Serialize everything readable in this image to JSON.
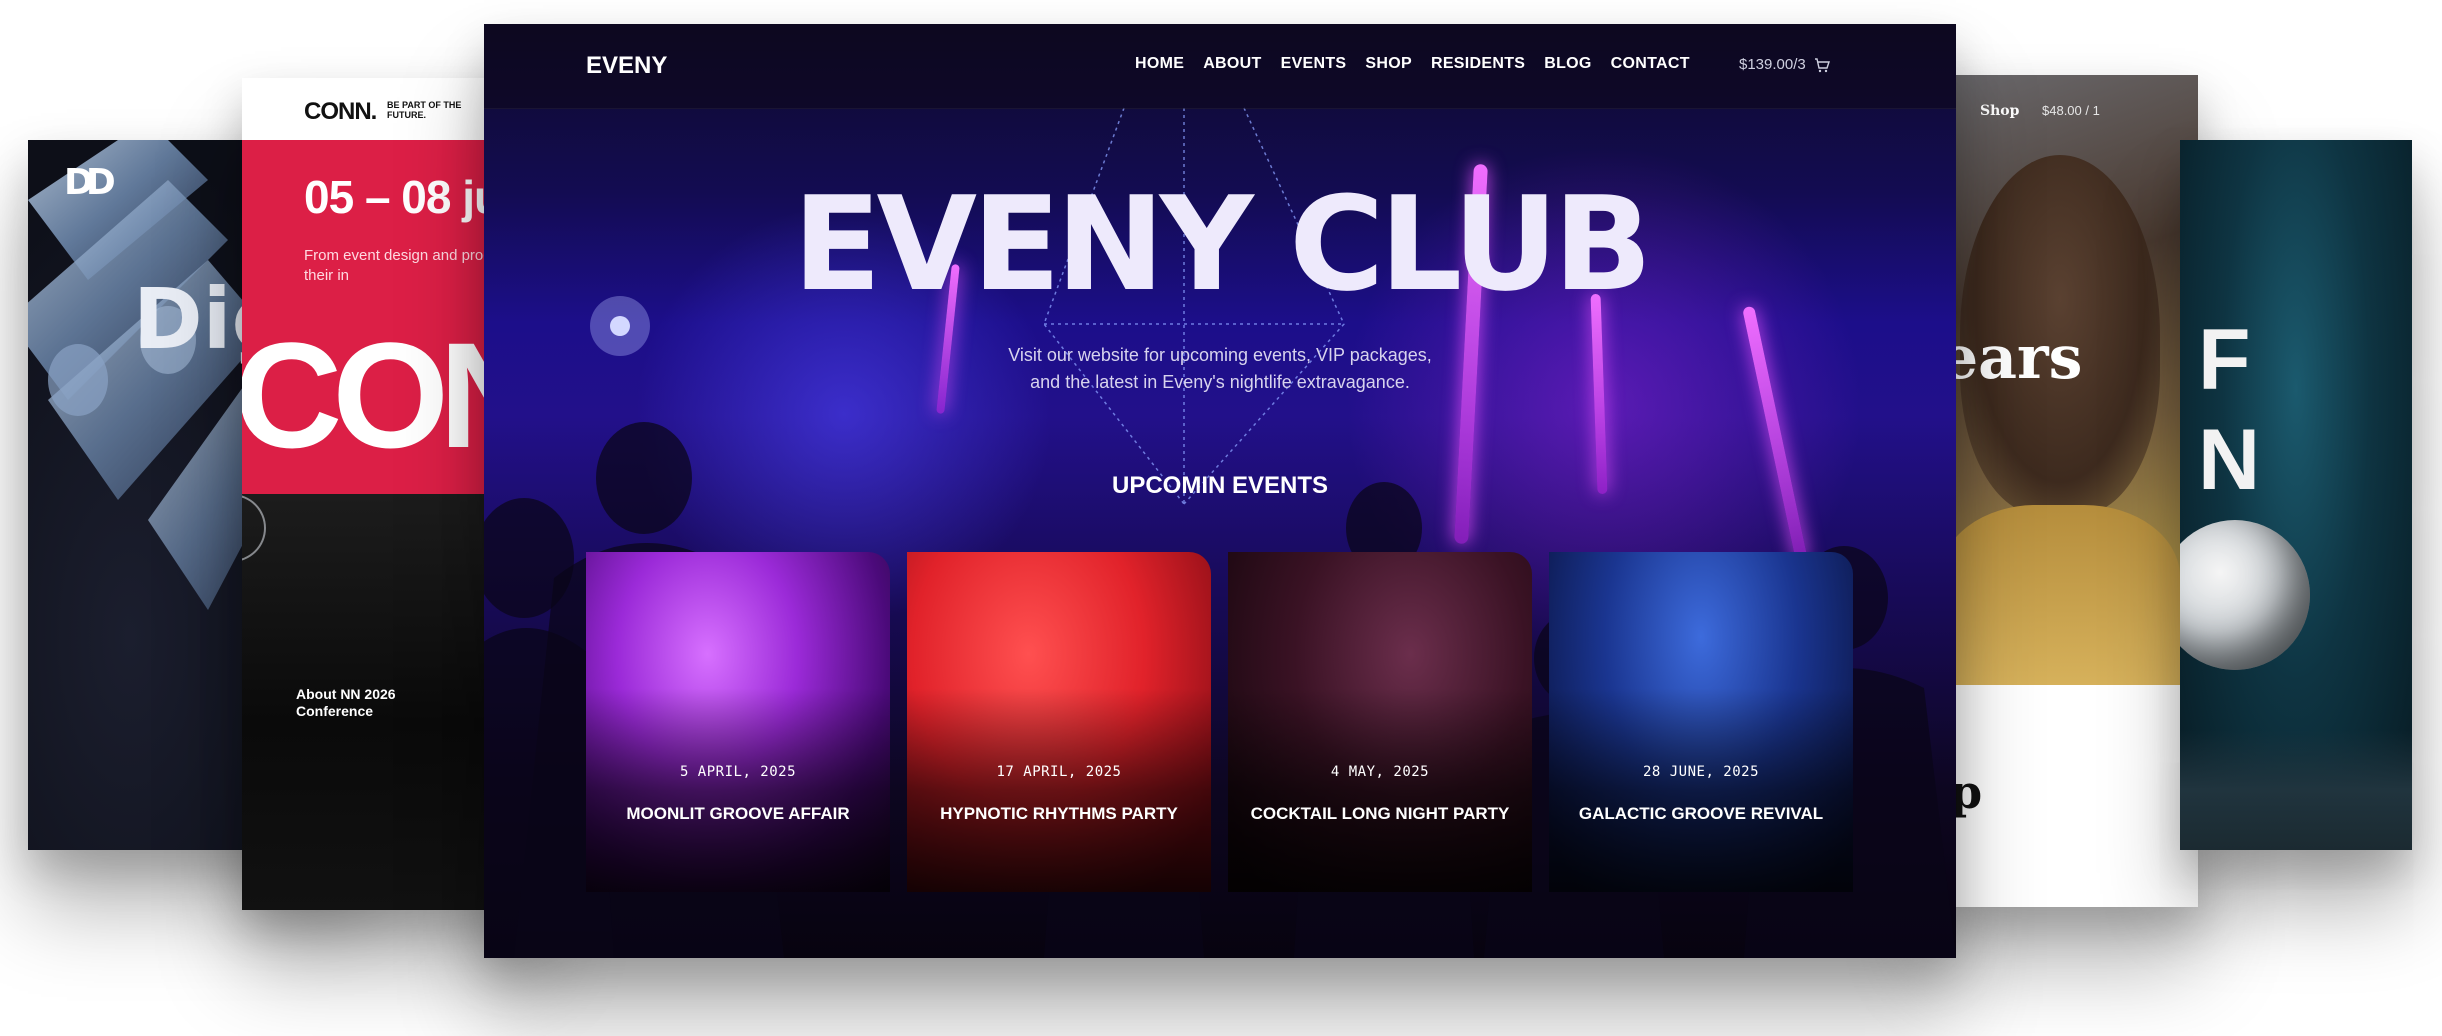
{
  "side_left": {
    "logo": "DD",
    "title": "Dig"
  },
  "conn": {
    "logo": "CONN.",
    "tagline": "BE PART OF THE FUTURE.",
    "date": "05 – 08 ju",
    "description": "From event design and proc speakers will share their in",
    "big_text": "CON",
    "about": "About NN 2026 Conference"
  },
  "side_right": {
    "nav_shop": "Shop",
    "nav_price": "$48.00 / 1",
    "title": "ears",
    "partial": "p"
  },
  "side_far_right": {
    "title_line1": "F",
    "title_line2": "N"
  },
  "main": {
    "logo": "EVENY",
    "nav": [
      "HOME",
      "ABOUT",
      "EVENTS",
      "SHOP",
      "RESIDENTS",
      "BLOG",
      "CONTACT"
    ],
    "cart": "$139.00/3",
    "hero_title": "EVENY CLUB",
    "hero_subtitle_line1": "Visit our website for upcoming events, VIP packages,",
    "hero_subtitle_line2": "and the latest in Eveny's nightlife extravagance.",
    "section_title": "UPCOMIN EVENTS",
    "events": [
      {
        "date": "5 APRIL, 2025",
        "name": "MOONLIT GROOVE AFFAIR"
      },
      {
        "date": "17 APRIL, 2025",
        "name": "HYPNOTIC RHYTHMS PARTY"
      },
      {
        "date": "4 MAY, 2025",
        "name": "COCKTAIL LONG NIGHT PARTY"
      },
      {
        "date": "28 JUNE, 2025",
        "name": "GALACTIC GROOVE REVIVAL"
      }
    ]
  }
}
